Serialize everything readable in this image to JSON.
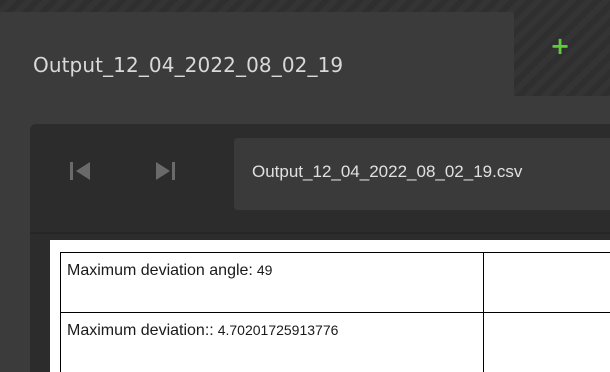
{
  "tabs": {
    "active_label": "Output_12_04_2022_08_02_19",
    "add_label": "+"
  },
  "toolbar": {
    "prev_icon": "skip-back-icon",
    "next_icon": "skip-forward-icon",
    "file_name": "Output_12_04_2022_08_02_19.csv"
  },
  "table": {
    "rows": [
      {
        "label": "Maximum deviation angle:",
        "value": "49"
      },
      {
        "label": "Maximum deviation::",
        "value": "4.70201725913776"
      }
    ]
  },
  "colors": {
    "accent_add": "#5ecb3c",
    "background": "#3b3b3b",
    "panel": "#2c2c2c"
  }
}
